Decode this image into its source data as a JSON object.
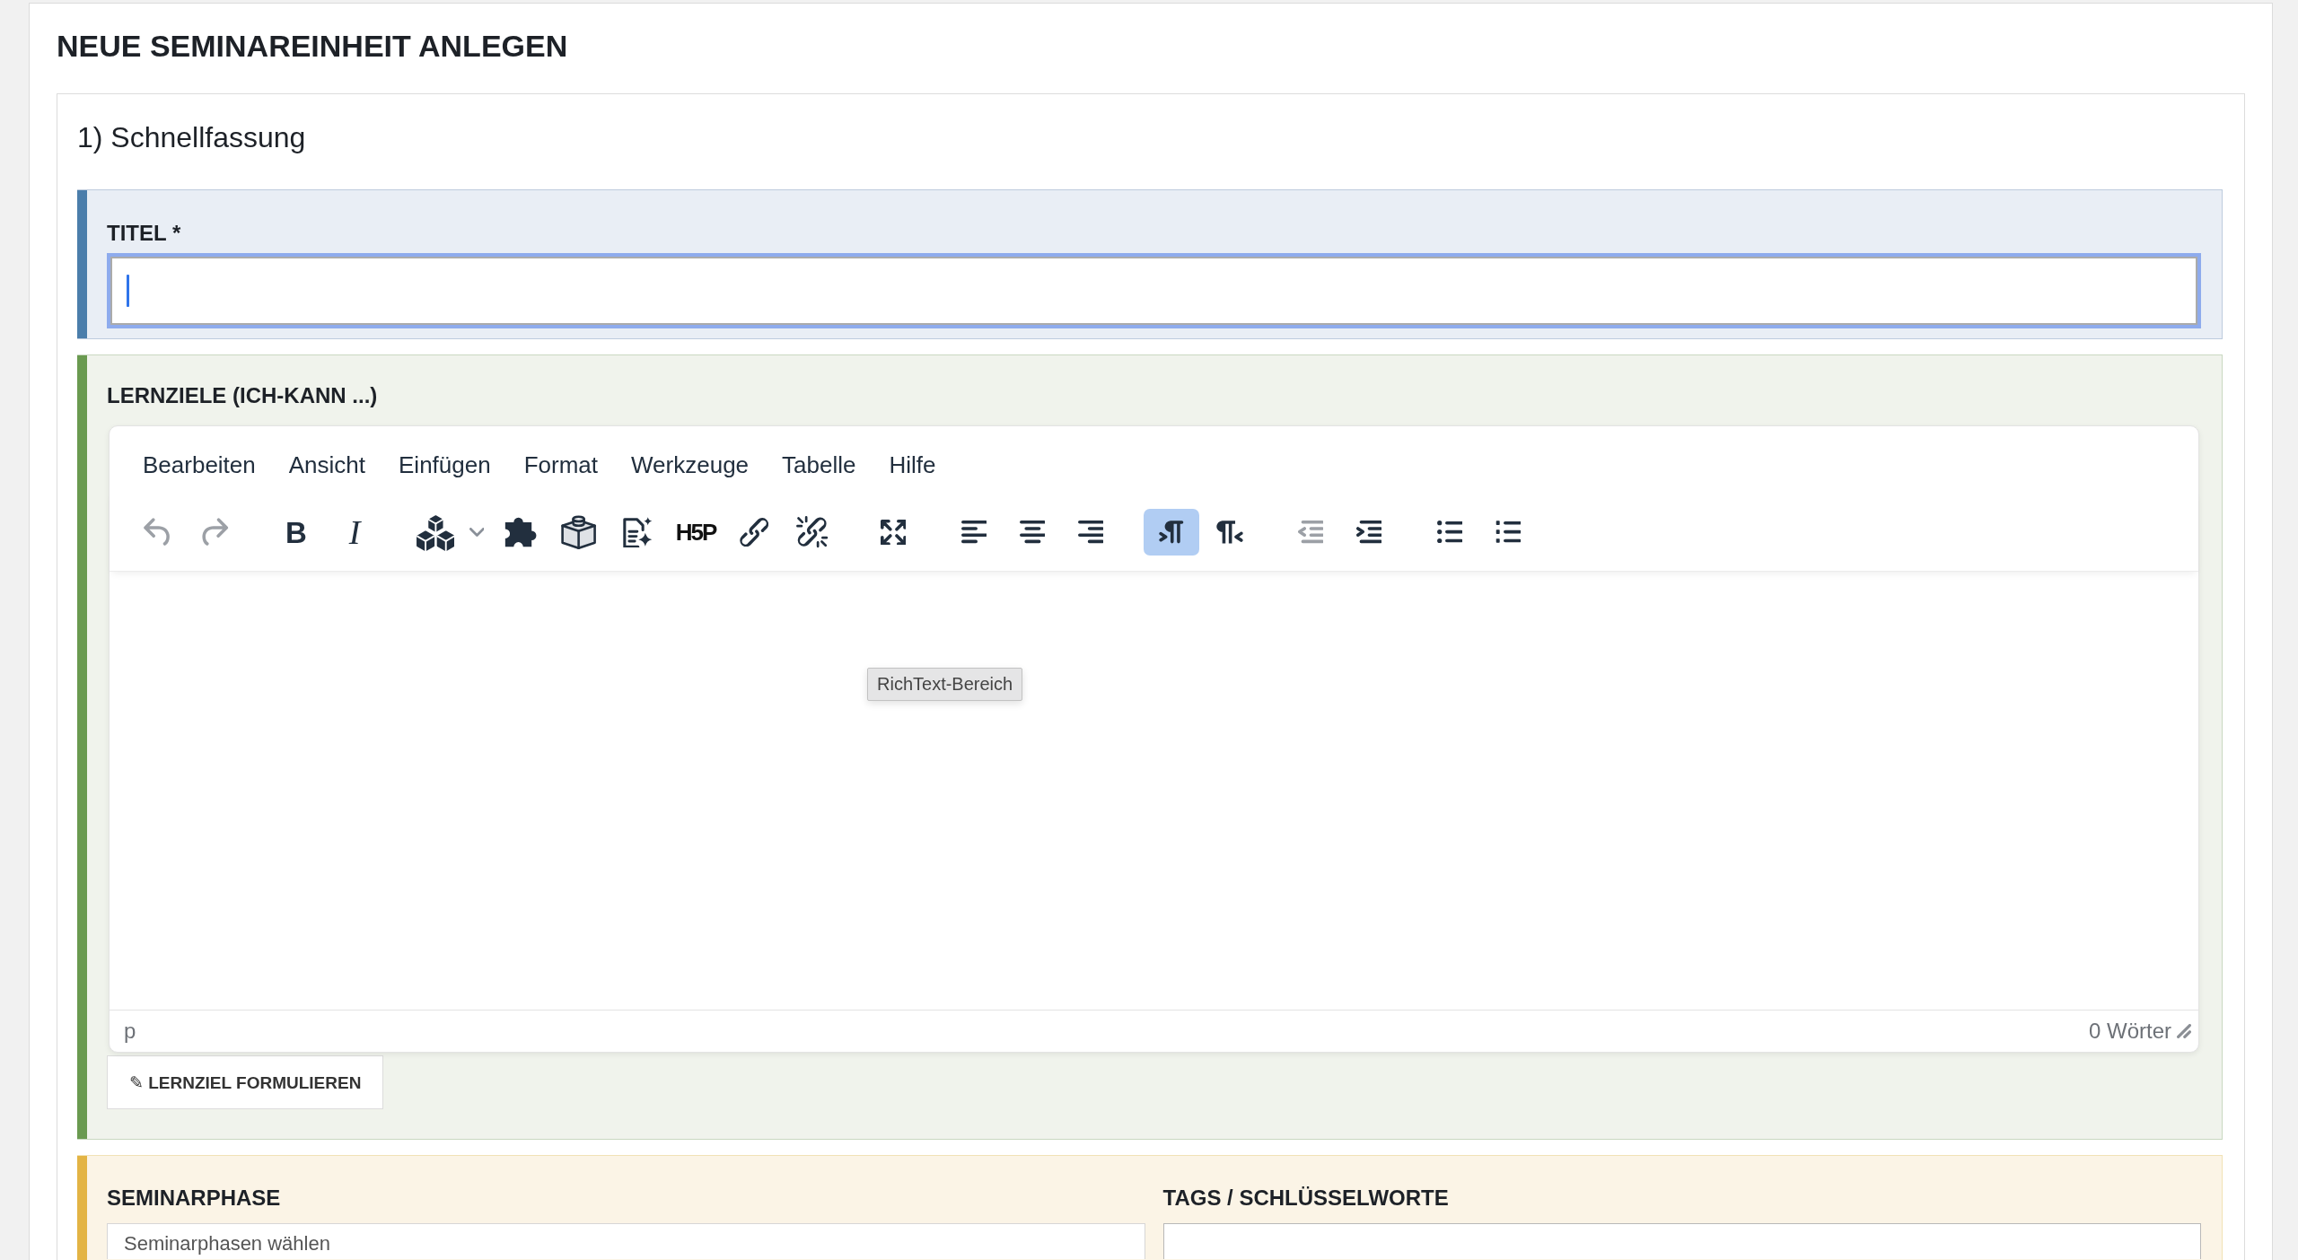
{
  "page": {
    "title": "NEUE SEMINAREINHEIT ANLEGEN"
  },
  "form": {
    "legend": "1) Schnellfassung",
    "sections": [
      {
        "kind": "text",
        "color": "#4b7eab",
        "label": "TITEL *",
        "field": {
          "focused": true
        }
      },
      {
        "kind": "editor",
        "color": "#6a9a50",
        "label": "LERNZIELE (ICH-KANN ...)",
        "editor": {
          "menu": [
            "Bearbeiten",
            "Ansicht",
            "Einfügen",
            "Format",
            "Werkzeuge",
            "Tabelle",
            "Hilfe"
          ],
          "toolbar": [
            [
              {
                "kind": "undo",
                "disabled": true,
                "active": false
              },
              {
                "kind": "redo",
                "disabled": true,
                "active": false
              }
            ],
            [
              {
                "kind": "bold",
                "text": "B",
                "disabled": false,
                "active": false
              },
              {
                "kind": "italic",
                "text": "I",
                "disabled": false,
                "active": false
              }
            ],
            [
              {
                "kind": "blocks",
                "disabled": false,
                "active": false
              },
              {
                "kind": "plugin",
                "disabled": false,
                "active": false
              },
              {
                "kind": "brick",
                "disabled": false,
                "active": false
              },
              {
                "kind": "ai_document",
                "disabled": false,
                "active": false
              },
              {
                "kind": "h5p",
                "text": "H5P",
                "disabled": false,
                "active": false
              },
              {
                "kind": "link",
                "disabled": false,
                "active": false
              },
              {
                "kind": "unlink",
                "disabled": false,
                "active": false
              }
            ],
            [
              {
                "kind": "fullscreen",
                "disabled": false,
                "active": false
              }
            ],
            [
              {
                "kind": "align_left",
                "disabled": false,
                "active": false
              },
              {
                "kind": "align_center",
                "disabled": false,
                "active": false
              },
              {
                "kind": "align_right",
                "disabled": false,
                "active": false
              }
            ],
            [
              {
                "kind": "ltr",
                "disabled": false,
                "active": true
              },
              {
                "kind": "rtl",
                "disabled": false,
                "active": false
              }
            ],
            [
              {
                "kind": "outdent",
                "disabled": true,
                "active": false
              },
              {
                "kind": "indent",
                "disabled": false,
                "active": false
              }
            ],
            [
              {
                "kind": "bullist",
                "disabled": false,
                "active": false
              },
              {
                "kind": "numlist",
                "disabled": false,
                "active": false
              }
            ]
          ],
          "tooltip": "RichText-Bereich",
          "element_path": "p",
          "word_count": "0 Wörter"
        },
        "button": "✎ LERNZIEL FORMULIEREN"
      },
      {
        "kind": "fields",
        "color": "#e3b445",
        "fields": [
          {
            "kind": "select",
            "label": "SEMINARPHASE",
            "placeholder": "Seminarphasen wählen"
          },
          {
            "kind": "tags",
            "label": "TAGS / SCHLÜSSELWORTE"
          }
        ]
      }
    ]
  }
}
